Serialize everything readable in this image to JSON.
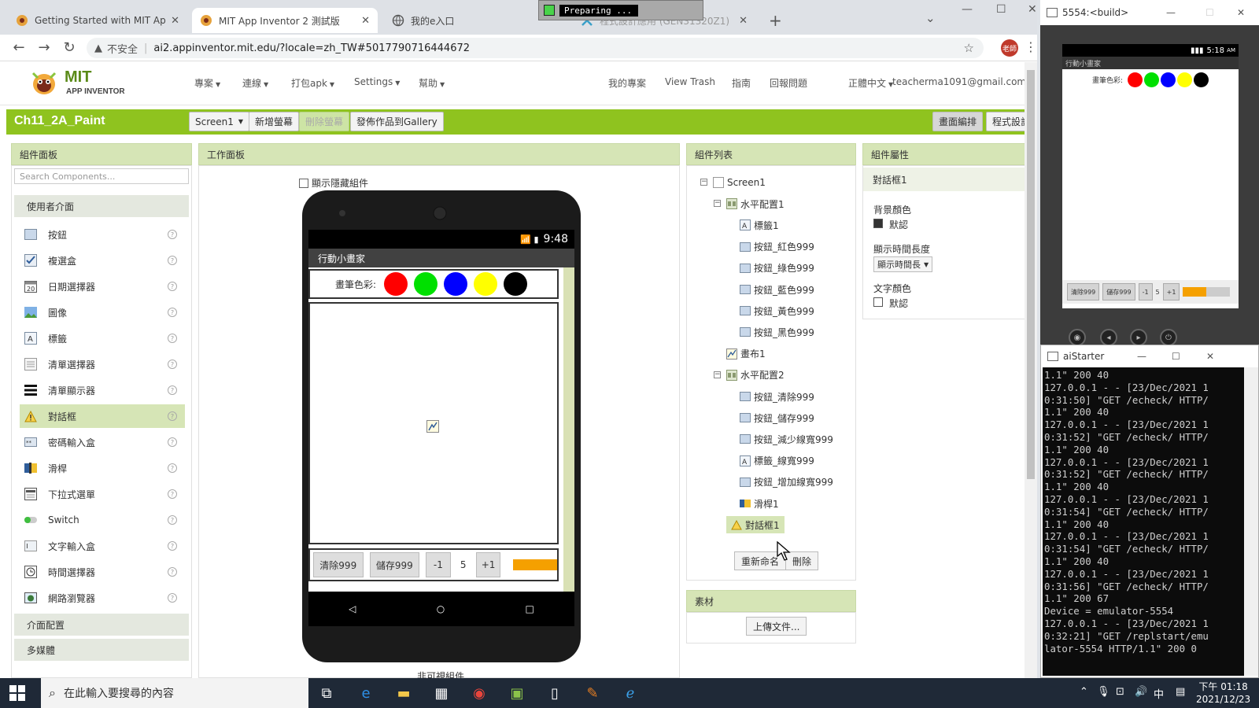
{
  "browser": {
    "tabs": [
      {
        "title": "Getting Started with MIT App",
        "active": false
      },
      {
        "title": "MIT App Inventor 2 測試版",
        "active": true
      },
      {
        "title": "我的e入口",
        "active": false
      },
      {
        "title": "程式設計應用 (GEN31320Z1)",
        "active": false
      }
    ],
    "preparing": "Preparing ...",
    "insecure_label": "不安全",
    "url": "ai2.appinventor.mit.edu/?locale=zh_TW#5017790716444672",
    "profile": "老師"
  },
  "app_inventor": {
    "logo_main": "MIT",
    "logo_sub": "APP INVENTOR",
    "menu": [
      "專案",
      "連線",
      "打包apk",
      "Settings",
      "幫助"
    ],
    "right_menu": {
      "my_projects": "我的專案",
      "view_trash": "View Trash",
      "guide": "指南",
      "report": "回報問題",
      "language": "正體中文",
      "account": "teacherma1091@gmail.com"
    },
    "project": {
      "name": "Ch11_2A_Paint",
      "screen_select": "Screen1",
      "add_screen": "新增螢幕",
      "remove_screen": "刪除螢幕",
      "publish": "發佈作品到Gallery",
      "designer": "畫面編排",
      "blocks": "程式設計"
    },
    "palette": {
      "title": "組件面板",
      "search_placeholder": "Search Components...",
      "category_ui": "使用者介面",
      "items": [
        "按鈕",
        "複選盒",
        "日期選擇器",
        "圖像",
        "標籤",
        "清單選擇器",
        "清單顯示器",
        "對話框",
        "密碼輸入盒",
        "滑桿",
        "下拉式選單",
        "Switch",
        "文字輸入盒",
        "時間選擇器",
        "網路瀏覽器"
      ],
      "selected_item": "對話框",
      "category_layout": "介面配置",
      "category_media": "多媒體"
    },
    "viewer": {
      "title": "工作面板",
      "show_hidden": "顯示隱藏組件",
      "time": "9:48",
      "app_title": "行動小畫家",
      "color_label": "畫筆色彩:",
      "colors": [
        "#ff0000",
        "#00e000",
        "#0000ff",
        "#ffff00",
        "#000000"
      ],
      "btn_clear": "清除999",
      "btn_save": "儲存999",
      "btn_minus": "-1",
      "width_value": "5",
      "btn_plus": "+1",
      "nonvisible": "非可視組件"
    },
    "components": {
      "title": "組件列表",
      "tree": [
        {
          "name": "Screen1",
          "level": 0,
          "toggle": true
        },
        {
          "name": "水平配置1",
          "level": 1,
          "toggle": true
        },
        {
          "name": "標籤1",
          "level": 2,
          "icon": "label"
        },
        {
          "name": "按鈕_紅色999",
          "level": 2,
          "icon": "button"
        },
        {
          "name": "按鈕_綠色999",
          "level": 2,
          "icon": "button"
        },
        {
          "name": "按鈕_藍色999",
          "level": 2,
          "icon": "button"
        },
        {
          "name": "按鈕_黃色999",
          "level": 2,
          "icon": "button"
        },
        {
          "name": "按鈕_黑色999",
          "level": 2,
          "icon": "button"
        },
        {
          "name": "畫布1",
          "level": 1,
          "icon": "canvas"
        },
        {
          "name": "水平配置2",
          "level": 1,
          "toggle": true
        },
        {
          "name": "按鈕_清除999",
          "level": 2,
          "icon": "button"
        },
        {
          "name": "按鈕_儲存999",
          "level": 2,
          "icon": "button"
        },
        {
          "name": "按鈕_減少線寬999",
          "level": 2,
          "icon": "button"
        },
        {
          "name": "標籤_線寬999",
          "level": 2,
          "icon": "label"
        },
        {
          "name": "按鈕_增加線寬999",
          "level": 2,
          "icon": "button"
        },
        {
          "name": "滑桿1",
          "level": 2,
          "icon": "slider"
        },
        {
          "name": "對話框1",
          "level": 1,
          "icon": "notifier",
          "selected": true
        }
      ],
      "rename": "重新命名",
      "delete": "刪除",
      "media_title": "素材",
      "upload": "上傳文件..."
    },
    "properties": {
      "title": "組件屬性",
      "component": "對話框1",
      "bg_color_label": "背景顏色",
      "bg_color_value": "默認",
      "duration_label": "顯示時間長度",
      "duration_value": "顯示時間長",
      "text_color_label": "文字顏色",
      "text_color_value": "默認"
    }
  },
  "emulator": {
    "title": "5554:<build>",
    "time": "5:18",
    "time_suffix": "AM",
    "app_title": "行動小畫家",
    "color_label": "畫筆色彩:",
    "colors": [
      "#ff0000",
      "#00e000",
      "#0000ff",
      "#ffff00",
      "#000000"
    ],
    "btn_clear": "清除999",
    "btn_save": "儲存999",
    "btn_minus": "-1",
    "width_value": "5",
    "btn_plus": "+1"
  },
  "aistarter": {
    "title": "aiStarter",
    "lines": [
      "1.1\" 200 40",
      "127.0.0.1 - - [23/Dec/2021 1",
      "0:31:50] \"GET /echeck/ HTTP/",
      "1.1\" 200 40",
      "127.0.0.1 - - [23/Dec/2021 1",
      "0:31:52] \"GET /echeck/ HTTP/",
      "1.1\" 200 40",
      "127.0.0.1 - - [23/Dec/2021 1",
      "0:31:52] \"GET /echeck/ HTTP/",
      "1.1\" 200 40",
      "127.0.0.1 - - [23/Dec/2021 1",
      "0:31:54] \"GET /echeck/ HTTP/",
      "1.1\" 200 40",
      "127.0.0.1 - - [23/Dec/2021 1",
      "0:31:54] \"GET /echeck/ HTTP/",
      "1.1\" 200 40",
      "127.0.0.1 - - [23/Dec/2021 1",
      "0:31:56] \"GET /echeck/ HTTP/",
      "1.1\" 200 67",
      "Device = emulator-5554",
      "127.0.0.1 - - [23/Dec/2021 1",
      "0:32:21] \"GET /replstart/emu",
      "lator-5554 HTTP/1.1\" 200 0"
    ]
  },
  "taskbar": {
    "search_placeholder": "在此輸入要搜尋的內容",
    "ime": "中",
    "time": "下午 01:18",
    "date": "2021/12/23"
  }
}
